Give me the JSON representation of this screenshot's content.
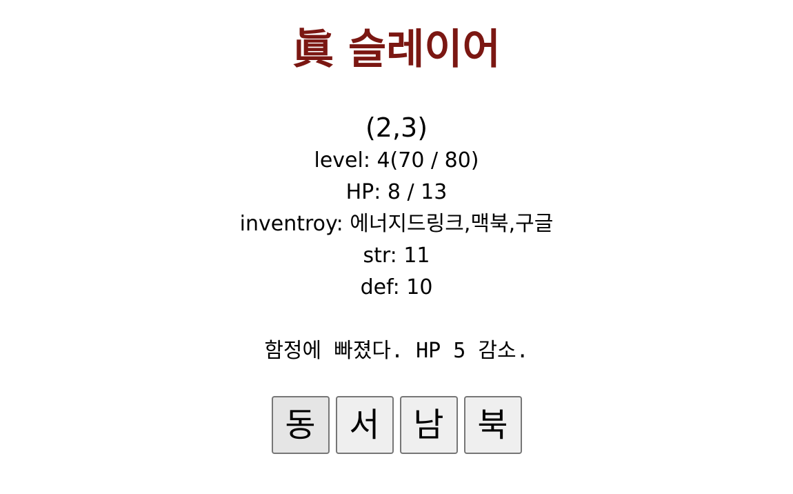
{
  "title": "眞 슬레이어",
  "colors": {
    "title": "#7b1712",
    "text": "#000000",
    "button_bg": "#efefef",
    "button_border": "#767676"
  },
  "player": {
    "position": "(2,3)",
    "level": "level: 4(70 / 80)",
    "hp": "HP: 8 / 13",
    "inventory": "inventroy: 에너지드링크,맥북,구글",
    "str": "str: 11",
    "def": "def: 10"
  },
  "message": "함정에 빠졌다. HP 5 감소.",
  "controls": {
    "east": "동",
    "west": "서",
    "south": "남",
    "north": "북"
  }
}
